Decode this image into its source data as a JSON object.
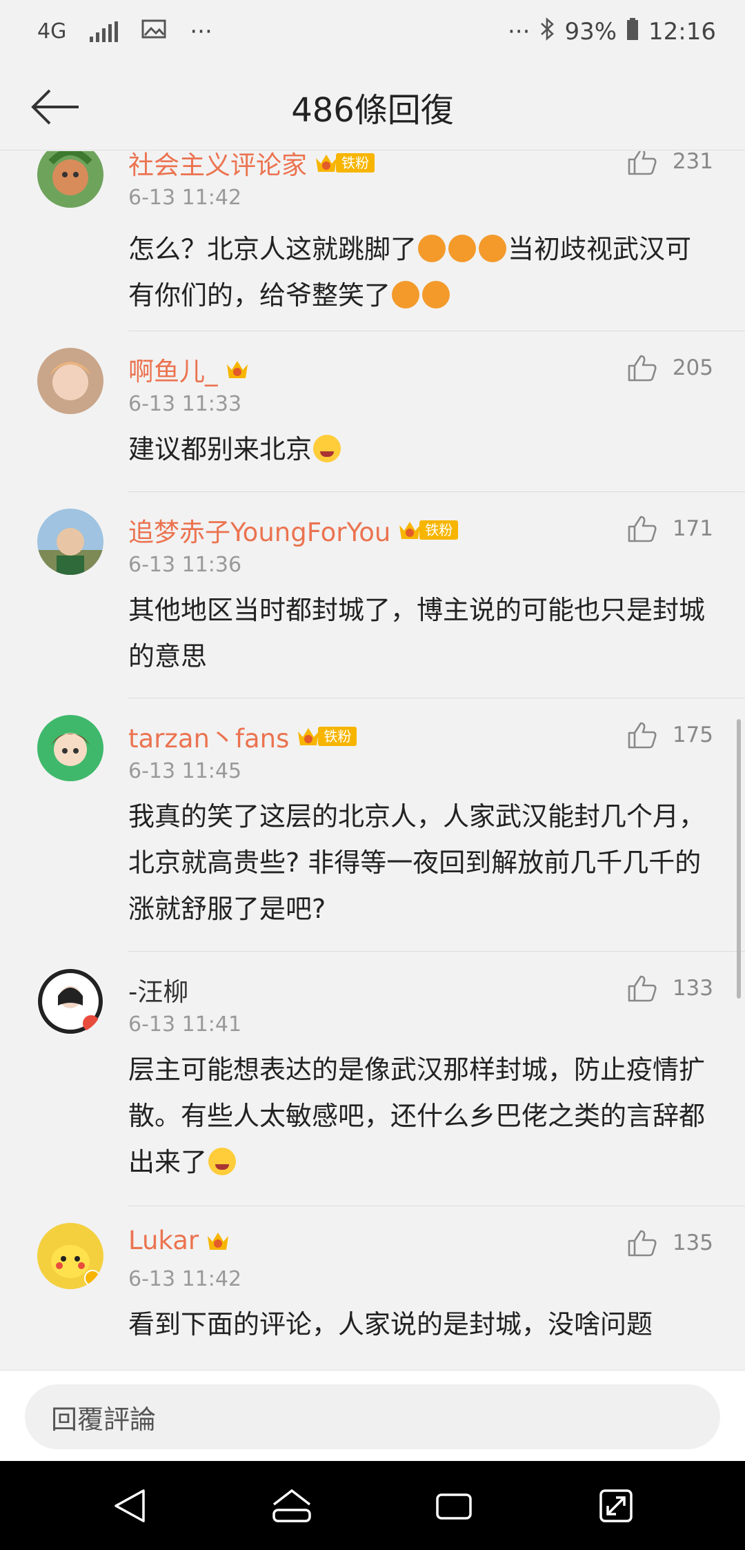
{
  "status_bar": {
    "network": "4G",
    "more": "···",
    "more_right": "···",
    "battery": "93%",
    "time": "12:16"
  },
  "header": {
    "title": "486條回復"
  },
  "comments": [
    {
      "username": "社会主义评论家",
      "badge": "铁粉",
      "time": "6-13 11:42",
      "text_a": "怎么？北京人这就跳脚了",
      "text_b": "当初歧视武汉可有你们的，给爷整笑了",
      "likes": "231"
    },
    {
      "username": "啊鱼儿_",
      "time": "6-13 11:33",
      "text": "建议都别来北京",
      "likes": "205"
    },
    {
      "username": "追梦赤子YoungForYou",
      "badge": "铁粉",
      "time": "6-13 11:36",
      "text": "其他地区当时都封城了，博主说的可能也只是封城的意思",
      "likes": "171"
    },
    {
      "username": "tarzan丶fans",
      "badge": "铁粉",
      "time": "6-13 11:45",
      "text": "我真的笑了这层的北京人，人家武汉能封几个月，北京就高贵些? 非得等一夜回到解放前几千几千的涨就舒服了是吧?",
      "likes": "175"
    },
    {
      "username": "-汪柳",
      "time": "6-13 11:41",
      "text": "层主可能想表达的是像武汉那样封城，防止疫情扩散。有些人太敏感吧，还什么乡巴佬之类的言辞都出来了",
      "likes": "133"
    },
    {
      "username": "Lukar",
      "time": "6-13 11:42",
      "text": "看到下面的评论，人家说的是封城，没啥问题",
      "likes": "135"
    }
  ],
  "composer": {
    "placeholder": "回覆評論"
  },
  "colors": {
    "username": "#eb7350",
    "background": "#f2f2f2",
    "accent": "#f7b500"
  },
  "icons": [
    "back-arrow-icon",
    "thumbs-up-icon",
    "crown-icon",
    "nav-back-icon",
    "nav-home-icon",
    "nav-recents-icon",
    "nav-rotate-icon"
  ]
}
